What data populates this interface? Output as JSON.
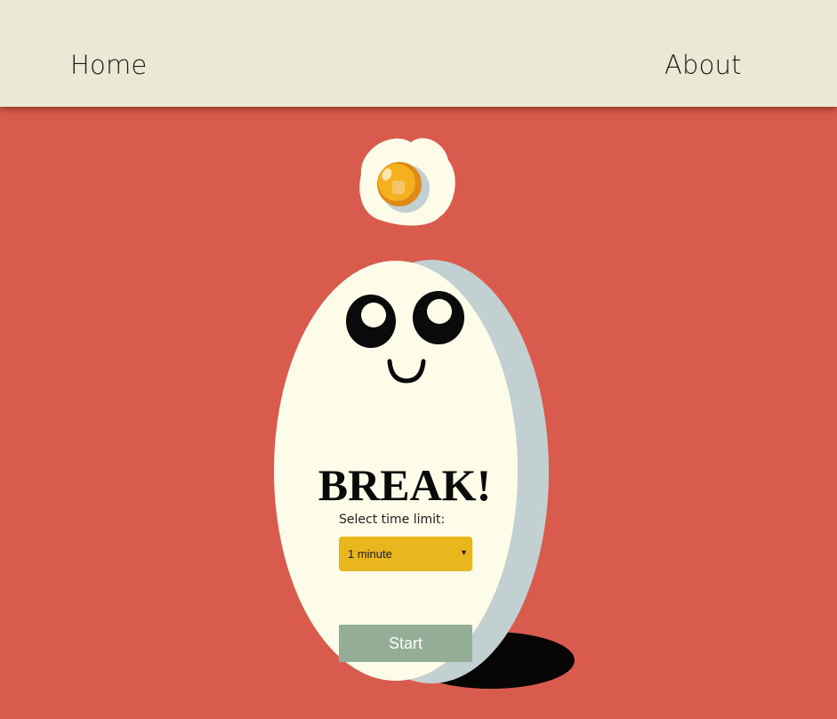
{
  "nav": {
    "home_label": "Home",
    "about_label": "About"
  },
  "main": {
    "title": "BREAK!",
    "time_label": "Select time limit:",
    "time_select": {
      "selected": "1 minute",
      "arrow": "▾"
    },
    "start_label": "Start"
  },
  "colors": {
    "background": "#d95b4d",
    "navbar": "#ece8d6",
    "egg_white": "#fcfce8",
    "egg_shade": "#c3d0d2",
    "yolk": "#f4b01f",
    "select_bg": "#e9b61e",
    "button_bg": "#93ad96"
  },
  "icons": {
    "fried_egg": "fried-egg-icon",
    "egg_character": "egg-character"
  }
}
